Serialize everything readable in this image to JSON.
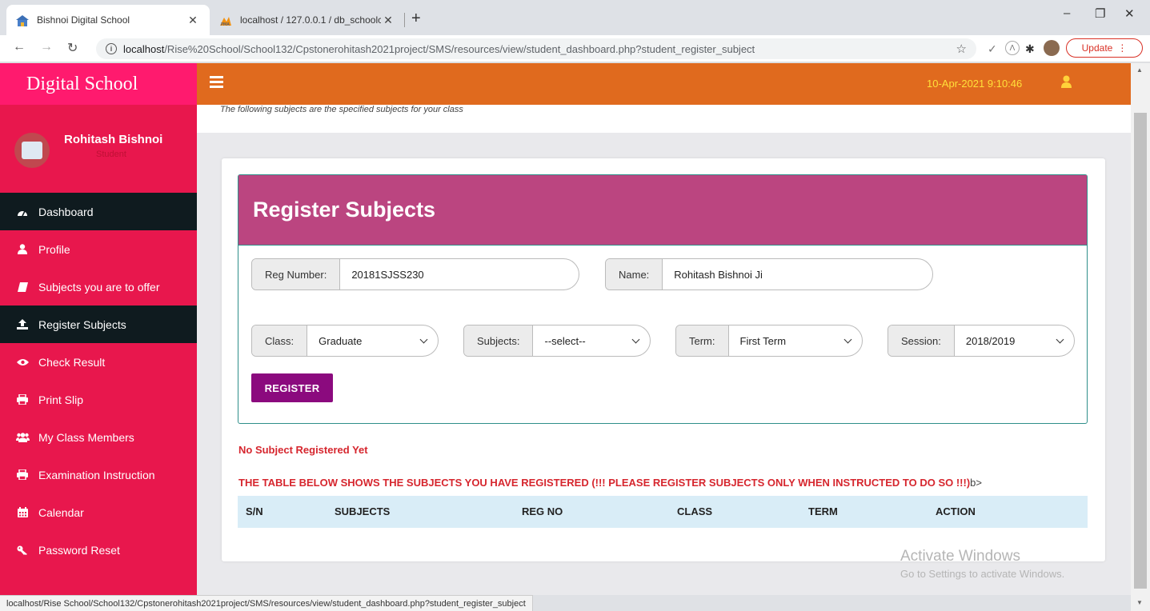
{
  "browser": {
    "tabs": [
      {
        "title": "Bishnoi Digital School"
      },
      {
        "title": "localhost / 127.0.0.1 / db_schoolc"
      }
    ],
    "url_host": "localhost",
    "url_path": "/Rise%20School/School132/Cpstonerohitash2021project/SMS/resources/view/student_dashboard.php?student_register_subject",
    "update_label": "Update",
    "status_url": "localhost/Rise School/School132/Cpstonerohitash2021project/SMS/resources/view/student_dashboard.php?student_register_subject"
  },
  "sidebar": {
    "brand": "Digital School",
    "user_name": "Rohitash Bishnoi",
    "user_role": "Student",
    "items": [
      {
        "label": "Dashboard",
        "icon": "tachometer-icon",
        "active": true
      },
      {
        "label": "Profile",
        "icon": "user-icon",
        "active": false
      },
      {
        "label": "Subjects you are to offer",
        "icon": "book-icon",
        "active": false
      },
      {
        "label": "Register Subjects",
        "icon": "upload-icon",
        "active": true
      },
      {
        "label": "Check Result",
        "icon": "eye-icon",
        "active": false
      },
      {
        "label": "Print Slip",
        "icon": "print-icon",
        "active": false
      },
      {
        "label": "My Class Members",
        "icon": "users-icon",
        "active": false
      },
      {
        "label": "Examination Instruction",
        "icon": "print-icon",
        "active": false
      },
      {
        "label": "Calendar",
        "icon": "calendar-icon",
        "active": false
      },
      {
        "label": "Password Reset",
        "icon": "key-icon",
        "active": false
      }
    ]
  },
  "topbar": {
    "datetime": "10-Apr-2021 9:10:46"
  },
  "header_note": "The following subjects are the specified subjects for your class",
  "form": {
    "title": "Register Subjects",
    "reg_label": "Reg Number:",
    "reg_value": "20181SJSS230",
    "name_label": "Name:",
    "name_value": "Rohitash Bishnoi Ji",
    "class_label": "Class:",
    "class_value": "Graduate",
    "subjects_label": "Subjects:",
    "subjects_value": "--select--",
    "term_label": "Term:",
    "term_value": "First Term",
    "session_label": "Session:",
    "session_value": "2018/2019",
    "register_label": "REGISTER"
  },
  "messages": {
    "no_subject": "No Subject Registered Yet",
    "table_note": "THE TABLE BELOW SHOWS THE SUBJECTS YOU HAVE REGISTERED (!!! PLEASE REGISTER SUBJECTS ONLY WHEN INSTRUCTED TO DO SO !!!)",
    "table_note_tail": "b>"
  },
  "table": {
    "headers": [
      "S/N",
      "SUBJECTS",
      "REG NO",
      "CLASS",
      "TERM",
      "ACTION"
    ]
  },
  "watermark": {
    "line1": "Activate Windows",
    "line2": "Go to Settings to activate Windows."
  },
  "colors": {
    "sidebar": "#e8174d",
    "brand": "#ff1a6e",
    "topbar": "#e06a1e",
    "panel_head": "#bb4580",
    "register_btn": "#8b0a7e",
    "message_red": "#d6262e"
  }
}
